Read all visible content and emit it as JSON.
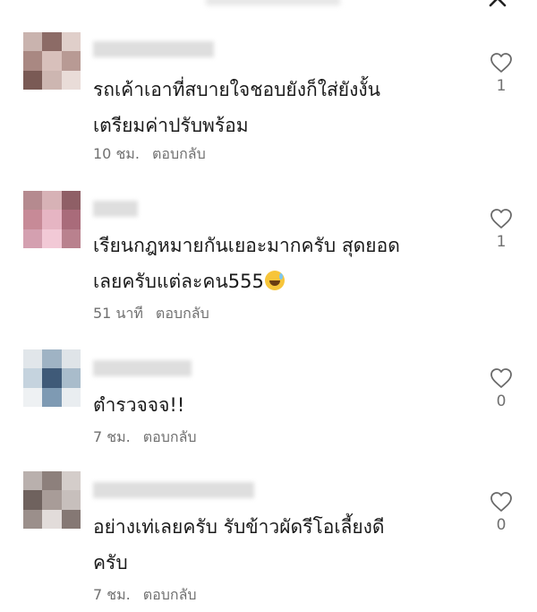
{
  "window": {
    "close_icon": "close-icon"
  },
  "comments": [
    {
      "username_hidden": true,
      "text_lines": [
        "รถเค้าเอาที่สบายใจชอบยังก็ใส่ยังงั้น",
        "เตรียมค่าปรับพร้อม"
      ],
      "time": "10 ชม.",
      "reply_label": "ตอบกลับ",
      "likes": "1",
      "avatar_colors": [
        "#c9b3ae",
        "#8c6b66",
        "#e0cfca",
        "#a98882",
        "#d8c0bb",
        "#b89a94",
        "#7a5a55",
        "#cdb6b1",
        "#e9dcd8"
      ]
    },
    {
      "username_hidden": true,
      "text_lines": [
        "เรียนกฎหมายกันเยอะมากครับ สุดยอด",
        "เลยครับแต่ละคน555"
      ],
      "emoji": "grinning-sweat-emoji",
      "time": "51 นาที",
      "reply_label": "ตอบกลับ",
      "likes": "1",
      "avatar_colors": [
        "#b58a8f",
        "#d7b2b6",
        "#8f5f66",
        "#c78a97",
        "#e6b5c3",
        "#a96b7a",
        "#d4a0b0",
        "#f2c9d6",
        "#b9818e"
      ]
    },
    {
      "username_hidden": true,
      "text_lines": [
        "ตำรวจจจ!!"
      ],
      "time": "7 ชม.",
      "reply_label": "ตอบกลับ",
      "likes": "0",
      "avatar_colors": [
        "#e1e6ea",
        "#9fb3c4",
        "#dfe4e8",
        "#c5d3de",
        "#3f5a78",
        "#a9bccb",
        "#eef1f3",
        "#7e9ab3",
        "#e9edf0"
      ]
    },
    {
      "username_hidden": true,
      "text_lines": [
        "อย่างเท่เลยครับ รับข้าวผัดรีโอเลี้ยงดี",
        "ครับ"
      ],
      "time": "7 ชม.",
      "reply_label": "ตอบกลับ",
      "likes": "0",
      "avatar_colors": [
        "#b9b0ad",
        "#8d807c",
        "#d4cdca",
        "#6f625e",
        "#a89c98",
        "#c7bfbc",
        "#9b8f8b",
        "#e2dcda",
        "#857874"
      ]
    }
  ]
}
